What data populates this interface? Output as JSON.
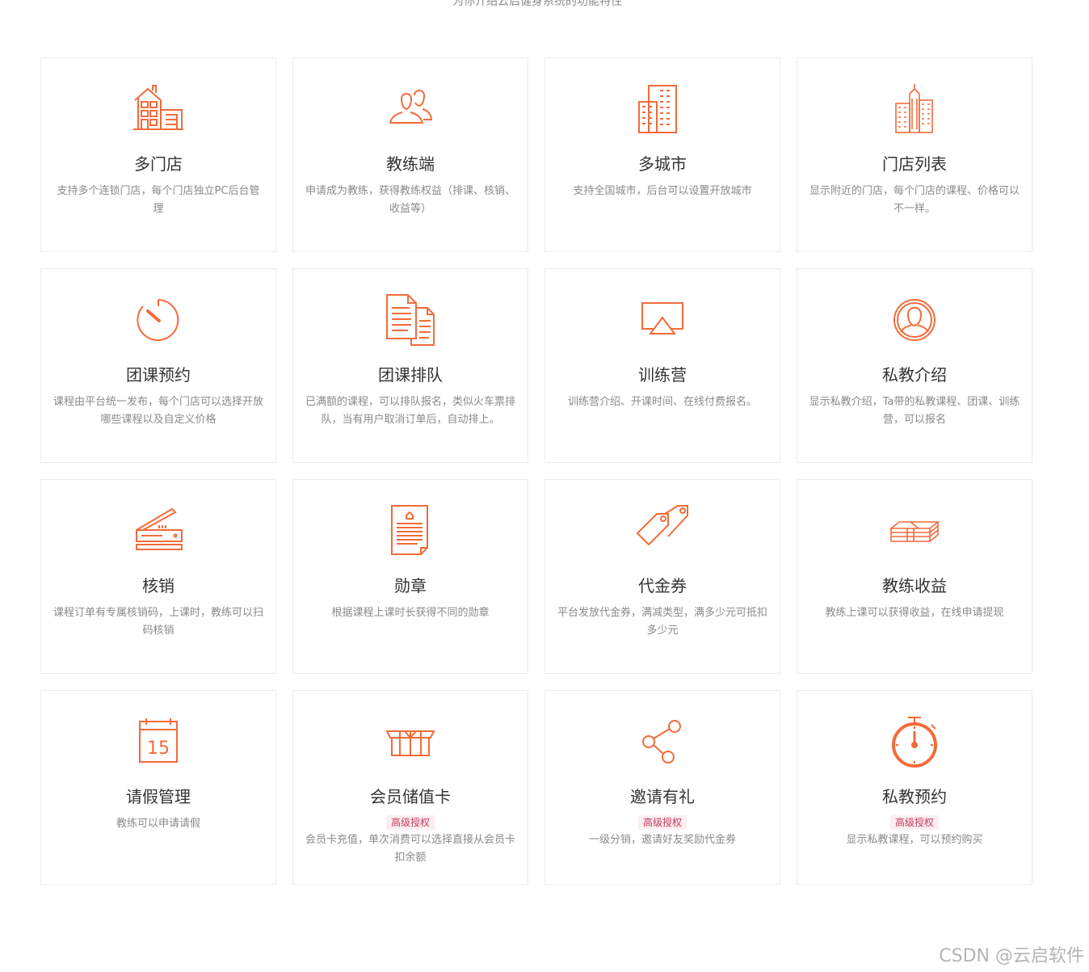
{
  "header": {
    "subtitle": "为你介绍云启健身系统的功能特性"
  },
  "features": [
    {
      "icon": "store-building-icon",
      "title": "多门店",
      "desc": "支持多个连锁门店，每个门店独立PC后台管理"
    },
    {
      "icon": "users-icon",
      "title": "教练端",
      "desc": "申请成为教练，获得教练权益（排课、核销、收益等）"
    },
    {
      "icon": "city-buildings-icon",
      "title": "多城市",
      "desc": "支持全国城市，后台可以设置开放城市"
    },
    {
      "icon": "skyscraper-icon",
      "title": "门店列表",
      "desc": "显示附近的门店，每个门店的课程、价格可以不一样。"
    },
    {
      "icon": "gauge-timer-icon",
      "title": "团课预约",
      "desc": "课程由平台统一发布，每个门店可以选择开放哪些课程以及自定义价格"
    },
    {
      "icon": "documents-icon",
      "title": "团课排队",
      "desc": "已满额的课程，可以排队报名，类似火车票排队，当有用户取消订单后，自动排上。"
    },
    {
      "icon": "screen-cast-icon",
      "title": "训练营",
      "desc": "训练营介绍、开课时间、在线付费报名。"
    },
    {
      "icon": "user-circle-icon",
      "title": "私教介绍",
      "desc": "显示私教介绍，Ta带的私教课程、团课、训练营，可以报名"
    },
    {
      "icon": "scanner-icon",
      "title": "核销",
      "desc": "课程订单有专属核销码，上课时，教练可以扫码核销"
    },
    {
      "icon": "certificate-icon",
      "title": "勋章",
      "desc": "根据课程上课时长获得不同的勋章"
    },
    {
      "icon": "price-tags-icon",
      "title": "代金券",
      "desc": "平台发放代金券，满减类型，满多少元可抵扣多少元"
    },
    {
      "icon": "money-stack-icon",
      "title": "教练收益",
      "desc": "教练上课可以获得收益，在线申请提现"
    },
    {
      "icon": "calendar-icon",
      "title": "请假管理",
      "desc": "教练可以申请请假",
      "calendar_day": "15"
    },
    {
      "icon": "gift-box-icon",
      "title": "会员储值卡",
      "badge": "高级授权",
      "desc": "会员卡充值，单次消费可以选择直接从会员卡扣余额"
    },
    {
      "icon": "share-icon",
      "title": "邀请有礼",
      "badge": "高级授权",
      "desc": "一级分销，邀请好友奖励代金券"
    },
    {
      "icon": "stopwatch-icon",
      "title": "私教预约",
      "badge": "高级授权",
      "desc": "显示私教课程，可以预约购买"
    }
  ],
  "watermark": "CSDN @云启软件",
  "colors": {
    "accent": "#f26b3a",
    "text": "#333333",
    "muted": "#8a8a8a",
    "badge_text": "#c23a5c",
    "badge_bg": "#fbeef1"
  }
}
